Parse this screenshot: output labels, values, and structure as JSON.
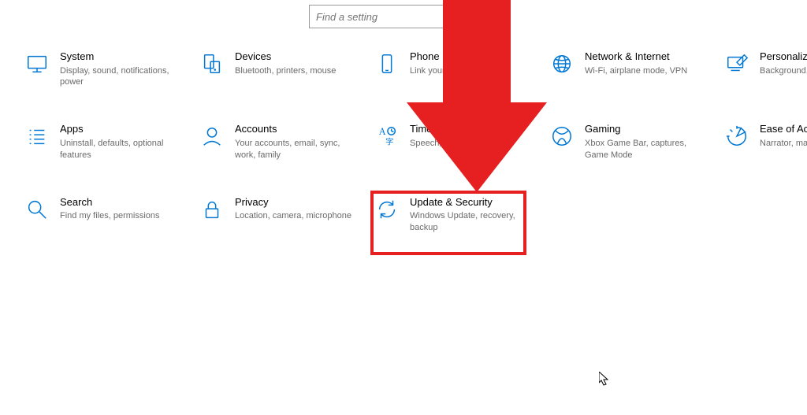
{
  "search": {
    "placeholder": "Find a setting"
  },
  "tiles": {
    "system": {
      "title": "System",
      "desc": "Display, sound, notifications, power"
    },
    "devices": {
      "title": "Devices",
      "desc": "Bluetooth, printers, mouse"
    },
    "phone": {
      "title": "Phone",
      "desc": "Link your"
    },
    "network": {
      "title": "Network & Internet",
      "desc": "Wi-Fi, airplane mode, VPN"
    },
    "personalize": {
      "title": "Personaliza",
      "desc": "Background,"
    },
    "apps": {
      "title": "Apps",
      "desc": "Uninstall, defaults, optional features"
    },
    "accounts": {
      "title": "Accounts",
      "desc": "Your accounts, email, sync, work, family"
    },
    "time": {
      "title": "Time & L",
      "desc": "Speech, regio"
    },
    "gaming": {
      "title": "Gaming",
      "desc": "Xbox Game Bar, captures, Game Mode"
    },
    "ease": {
      "title": "Ease of Acc",
      "desc": "Narrator, ma\ncontrast"
    },
    "search_cat": {
      "title": "Search",
      "desc": "Find my files, permissions"
    },
    "privacy": {
      "title": "Privacy",
      "desc": "Location, camera, microphone"
    },
    "update": {
      "title": "Update & Security",
      "desc": "Windows Update, recovery, backup"
    }
  },
  "annotation": {
    "highlight_color": "#E62020",
    "arrow_color": "#E62020"
  }
}
